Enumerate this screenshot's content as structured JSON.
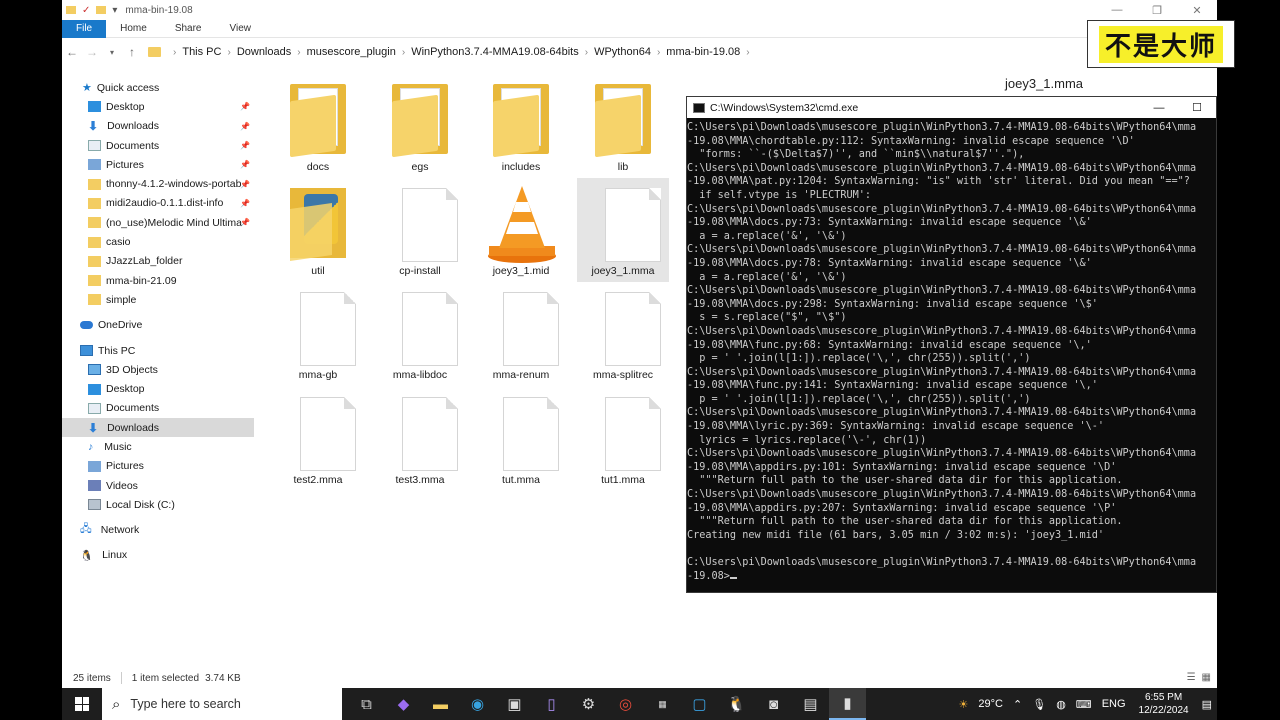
{
  "window": {
    "title": "mma-bin-19.08",
    "controls": [
      "—",
      "❐",
      "✕"
    ]
  },
  "ribbon": {
    "tabs": [
      "File",
      "Home",
      "Share",
      "View"
    ]
  },
  "address": {
    "crumbs": [
      "This PC",
      "Downloads",
      "musescore_plugin",
      "WinPython3.7.4-MMA19.08-64bits",
      "WPython64",
      "mma-bin-19.08"
    ]
  },
  "nav": {
    "quick_access": "Quick access",
    "pinned": [
      "Desktop",
      "Downloads",
      "Documents",
      "Pictures",
      "thonny-4.1.2-windows-portab",
      "midi2audio-0.1.1.dist-info",
      "(no_use)Melodic Mind Ultima"
    ],
    "folders": [
      "casio",
      "JJazzLab_folder",
      "mma-bin-21.09",
      "simple"
    ],
    "onedrive": "OneDrive",
    "this_pc": "This PC",
    "pc_items": [
      "3D Objects",
      "Desktop",
      "Documents",
      "Downloads",
      "Music",
      "Pictures",
      "Videos",
      "Local Disk (C:)"
    ],
    "network": "Network",
    "linux": "Linux"
  },
  "files": [
    {
      "name": "docs",
      "type": "folder"
    },
    {
      "name": "egs",
      "type": "folder"
    },
    {
      "name": "includes",
      "type": "folder"
    },
    {
      "name": "lib",
      "type": "folder"
    },
    {
      "name": "util",
      "type": "pyfolder"
    },
    {
      "name": "cp-install",
      "type": "file"
    },
    {
      "name": "joey3_1.mid",
      "type": "vlc"
    },
    {
      "name": "joey3_1.mma",
      "type": "file",
      "selected": true
    },
    {
      "name": "mma-gb",
      "type": "file"
    },
    {
      "name": "mma-libdoc",
      "type": "file"
    },
    {
      "name": "mma-renum",
      "type": "file"
    },
    {
      "name": "mma-splitrec",
      "type": "file"
    },
    {
      "name": "test2.mma",
      "type": "file"
    },
    {
      "name": "test3.mma",
      "type": "file"
    },
    {
      "name": "tut.mma",
      "type": "file"
    },
    {
      "name": "tut1.mma",
      "type": "file"
    }
  ],
  "preview_title": "joey3_1.mma",
  "cmd": {
    "title": "C:\\Windows\\System32\\cmd.exe",
    "lines": [
      "C:\\Users\\pi\\Downloads\\musescore_plugin\\WinPython3.7.4-MMA19.08-64bits\\WPython64\\mma",
      "-19.08\\MMA\\chordtable.py:112: SyntaxWarning: invalid escape sequence '\\D'",
      "  \"forms: ``-($\\Delta$7)'', and ``min$\\\\natural$7''.\"),",
      "C:\\Users\\pi\\Downloads\\musescore_plugin\\WinPython3.7.4-MMA19.08-64bits\\WPython64\\mma",
      "-19.08\\MMA\\pat.py:1204: SyntaxWarning: \"is\" with 'str' literal. Did you mean \"==\"?",
      "  if self.vtype is 'PLECTRUM':",
      "C:\\Users\\pi\\Downloads\\musescore_plugin\\WinPython3.7.4-MMA19.08-64bits\\WPython64\\mma",
      "-19.08\\MMA\\docs.py:73: SyntaxWarning: invalid escape sequence '\\&'",
      "  a = a.replace('&', '\\&')",
      "C:\\Users\\pi\\Downloads\\musescore_plugin\\WinPython3.7.4-MMA19.08-64bits\\WPython64\\mma",
      "-19.08\\MMA\\docs.py:78: SyntaxWarning: invalid escape sequence '\\&'",
      "  a = a.replace('&', '\\&')",
      "C:\\Users\\pi\\Downloads\\musescore_plugin\\WinPython3.7.4-MMA19.08-64bits\\WPython64\\mma",
      "-19.08\\MMA\\docs.py:298: SyntaxWarning: invalid escape sequence '\\$'",
      "  s = s.replace(\"$\", \"\\$\")",
      "C:\\Users\\pi\\Downloads\\musescore_plugin\\WinPython3.7.4-MMA19.08-64bits\\WPython64\\mma",
      "-19.08\\MMA\\func.py:68: SyntaxWarning: invalid escape sequence '\\,'",
      "  p = ' '.join(l[1:]).replace('\\,', chr(255)).split(',')",
      "C:\\Users\\pi\\Downloads\\musescore_plugin\\WinPython3.7.4-MMA19.08-64bits\\WPython64\\mma",
      "-19.08\\MMA\\func.py:141: SyntaxWarning: invalid escape sequence '\\,'",
      "  p = ' '.join(l[1:]).replace('\\,', chr(255)).split(',')",
      "C:\\Users\\pi\\Downloads\\musescore_plugin\\WinPython3.7.4-MMA19.08-64bits\\WPython64\\mma",
      "-19.08\\MMA\\lyric.py:369: SyntaxWarning: invalid escape sequence '\\-'",
      "  lyrics = lyrics.replace('\\-', chr(1))",
      "C:\\Users\\pi\\Downloads\\musescore_plugin\\WinPython3.7.4-MMA19.08-64bits\\WPython64\\mma",
      "-19.08\\MMA\\appdirs.py:101: SyntaxWarning: invalid escape sequence '\\D'",
      "  \"\"\"Return full path to the user-shared data dir for this application.",
      "C:\\Users\\pi\\Downloads\\musescore_plugin\\WinPython3.7.4-MMA19.08-64bits\\WPython64\\mma",
      "-19.08\\MMA\\appdirs.py:207: SyntaxWarning: invalid escape sequence '\\P'",
      "  \"\"\"Return full path to the user-shared data dir for this application.",
      "Creating new midi file (61 bars, 3.05 min / 3:02 m:s): 'joey3_1.mid'",
      "",
      "C:\\Users\\pi\\Downloads\\musescore_plugin\\WinPython3.7.4-MMA19.08-64bits\\WPython64\\mma",
      "-19.08>"
    ]
  },
  "overlay_logo": "不是大师",
  "status": {
    "items": "25 items",
    "selected": "1 item selected",
    "size": "3.74 KB"
  },
  "taskbar": {
    "search_placeholder": "Type here to search",
    "weather": "29°C",
    "lang": "ENG",
    "time": "6:55 PM",
    "date": "12/22/2024"
  }
}
